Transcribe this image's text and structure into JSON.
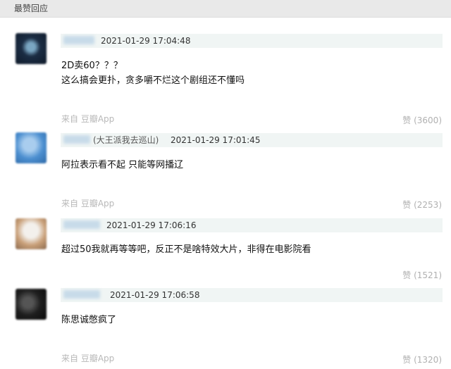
{
  "header": {
    "title": "最赞回应"
  },
  "comments": [
    {
      "timestamp": "2021-01-29 17:04:48",
      "lines": [
        "2D卖60？？？",
        "这么搞会更扑，贪多嚼不烂这个剧组还不懂吗"
      ],
      "source": "来自 豆瓣App",
      "likes": "赞 (3600)",
      "avatar_colors": [
        "#1b2d44",
        "#7aa6c2"
      ]
    },
    {
      "username_suffix": "(大王派我去巡山)",
      "timestamp": "2021-01-29 17:01:45",
      "lines": [
        "阿拉表示看不起 只能等网播辽"
      ],
      "source": "来自 豆瓣App",
      "likes": "赞 (2253)",
      "avatar_colors": [
        "#4c8fd0",
        "#a9cdee"
      ]
    },
    {
      "timestamp": "2021-01-29 17:06:16",
      "lines": [
        "超过50我就再等等吧，反正不是啥特效大片，非得在电影院看"
      ],
      "likes": "赞 (1521)",
      "avatar_colors": [
        "#c9a079",
        "#f3f0ec"
      ]
    },
    {
      "timestamp": "2021-01-29 17:06:58",
      "lines": [
        "陈思诚憋疯了"
      ],
      "source": "来自 豆瓣App",
      "likes": "赞 (1320)",
      "avatar_colors": [
        "#111111",
        "#555555"
      ]
    }
  ]
}
